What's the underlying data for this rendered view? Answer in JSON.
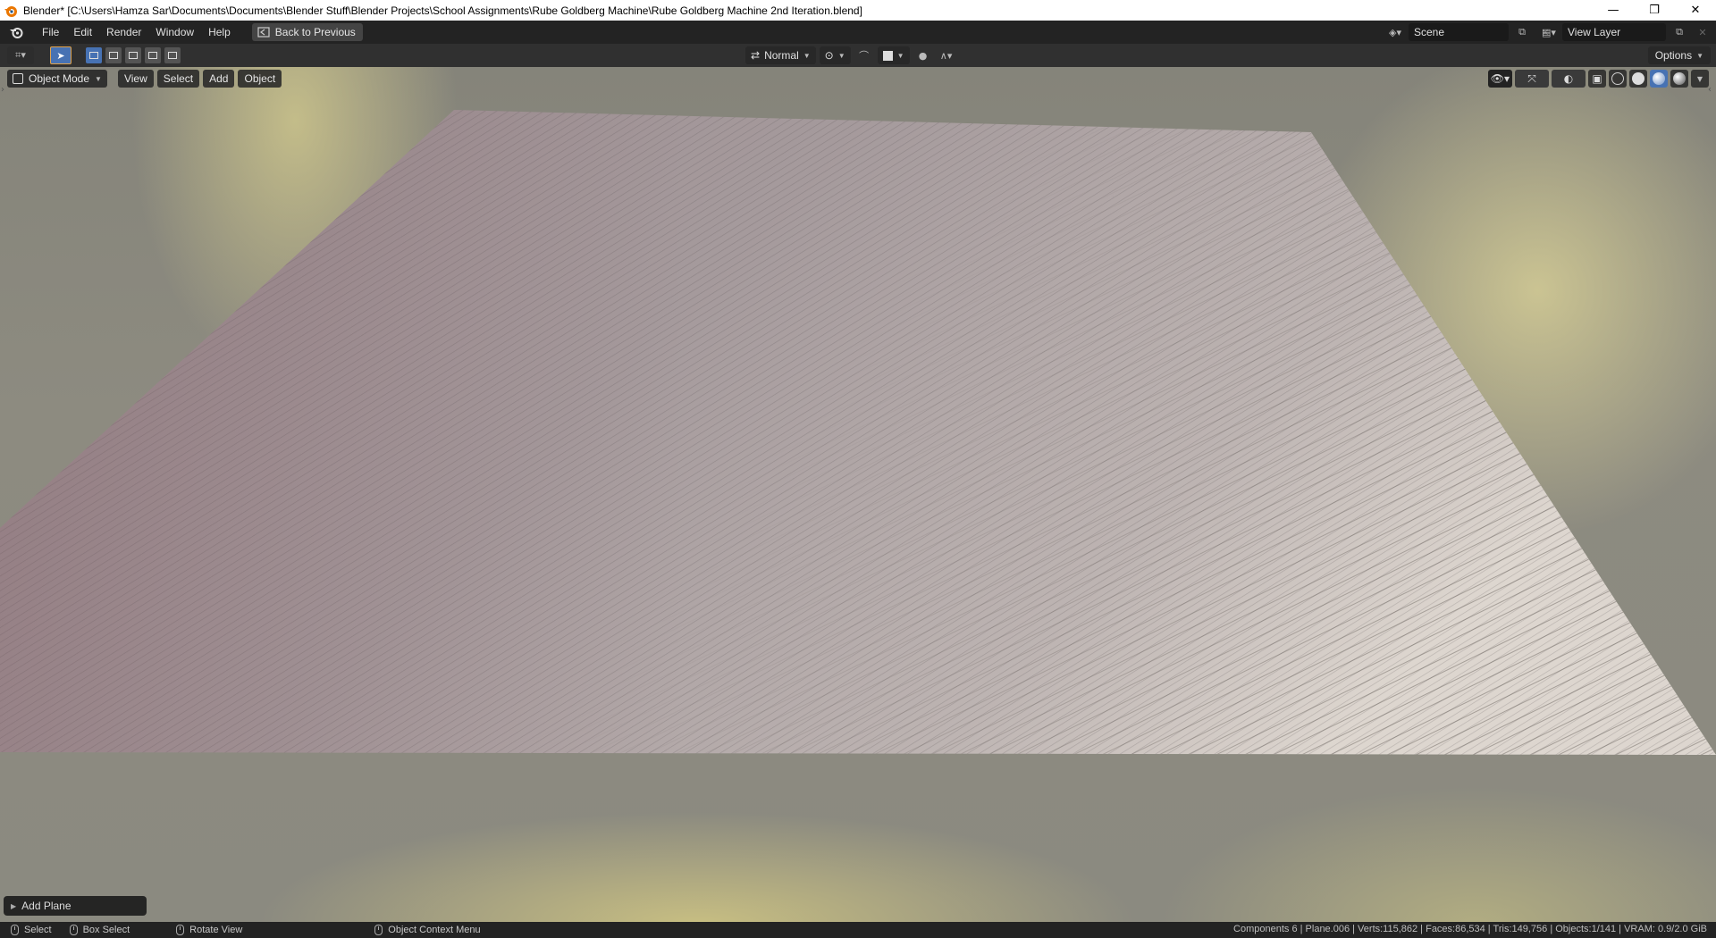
{
  "window": {
    "title": "Blender* [C:\\Users\\Hamza Sar\\Documents\\Documents\\Blender Stuff\\Blender Projects\\School Assignments\\Rube Goldberg Machine\\Rube Goldberg Machine 2nd Iteration.blend]",
    "controls": {
      "minimize": "—",
      "maximize": "❐",
      "close": "✕"
    }
  },
  "menubar": {
    "items": [
      "File",
      "Edit",
      "Render",
      "Window",
      "Help"
    ],
    "back_label": "Back to Previous",
    "scene": "Scene",
    "view_layer": "View Layer"
  },
  "toolheader": {
    "orientation": "Normal",
    "options_label": "Options"
  },
  "viewport": {
    "mode": "Object Mode",
    "menus": [
      "View",
      "Select",
      "Add",
      "Object"
    ],
    "last_operator": "Add Plane"
  },
  "statusbar": {
    "select": "Select",
    "box_select": "Box Select",
    "rotate_view": "Rotate View",
    "context_menu": "Object Context Menu",
    "stats": "Components 6 | Plane.006 | Verts:115,862 | Faces:86,534 | Tris:149,756 | Objects:1/141 | VRAM: 0.9/2.0 GiB"
  },
  "colors": {
    "accent": "#4772b3",
    "active_outline": "#e2a34a",
    "header_bg": "#303030",
    "plane_tint": "#9d8f92"
  },
  "icons": [
    "blender-logo-icon",
    "back-icon",
    "scene-icon",
    "view-layer-icon",
    "select-tool-icon",
    "pivot-icon",
    "snap-icon",
    "proportional-icon",
    "visibility-icon",
    "gizmo-icon",
    "overlay-icon",
    "xray-icon",
    "wireframe-shading-icon",
    "solid-shading-icon",
    "material-shading-icon",
    "rendered-shading-icon",
    "mouse-left-icon",
    "mouse-middle-icon",
    "mouse-right-icon"
  ]
}
